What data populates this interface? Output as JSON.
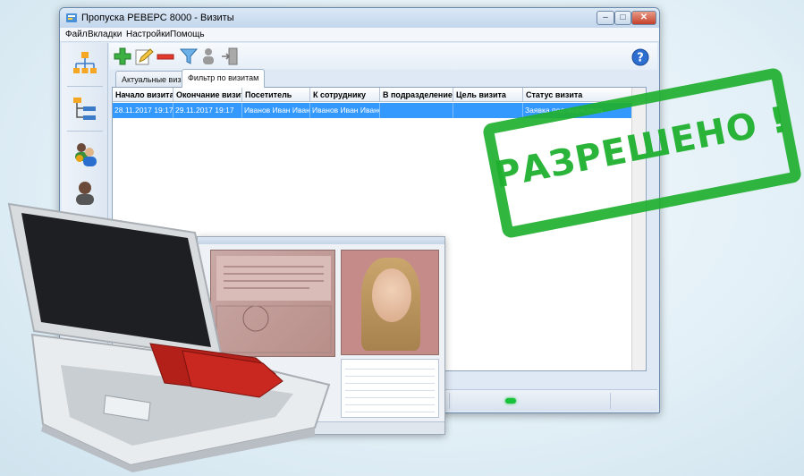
{
  "window": {
    "title": "Пропуска РЕВЕРС 8000 - Визиты",
    "buttons": {
      "minimize": "–",
      "maximize": "□",
      "close": "✕"
    }
  },
  "menu": [
    "Файл",
    "Вкладки",
    "Настройки",
    "Помощь"
  ],
  "toolbar": {
    "icons": [
      "add-icon",
      "edit-icon",
      "delete-icon",
      "filter-icon",
      "user-exit-icon"
    ],
    "help": "?"
  },
  "sidebar": {
    "icons": [
      "org-structure-icon",
      "hierarchy-icon",
      "users-icon",
      "person-icon"
    ]
  },
  "tabs": [
    "Актуальные визиты",
    "Фильтр по визитам"
  ],
  "table": {
    "columns": [
      "Начало визита",
      "Окончание визита",
      "Посетитель",
      "К сотруднику",
      "В подразделение",
      "Цель визита",
      "Статус визита"
    ],
    "rows": [
      [
        "28.11.2017 19:17",
        "29.11.2017 19:17",
        "Иванов Иван Иван...",
        "Иванов Иван Ивано...",
        "",
        "",
        "Заявка подтверждена"
      ]
    ]
  },
  "stamp": {
    "text": "РАЗРЕШЕНО !"
  },
  "colors": {
    "selection": "#3399ff",
    "stamp": "#1fb02f",
    "status_led": "#18c13a"
  }
}
